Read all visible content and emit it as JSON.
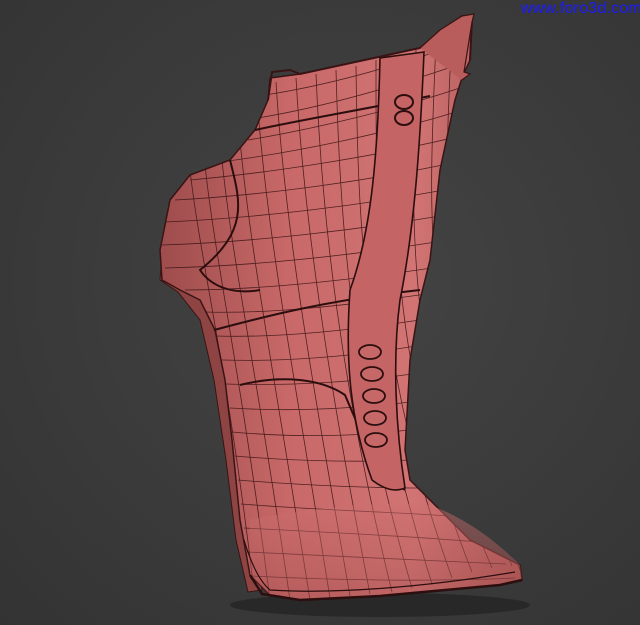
{
  "viewport": {
    "background": "#3b3b3b",
    "watermark": "www.foro3d.com",
    "watermark_color": "#1a1aff"
  },
  "model": {
    "subject": "boot-wireframe-mesh",
    "base_color": "#c46565",
    "wire_color": "#3a1414",
    "shadow_color": "#1e1e1e",
    "lace_hooks": 5
  }
}
